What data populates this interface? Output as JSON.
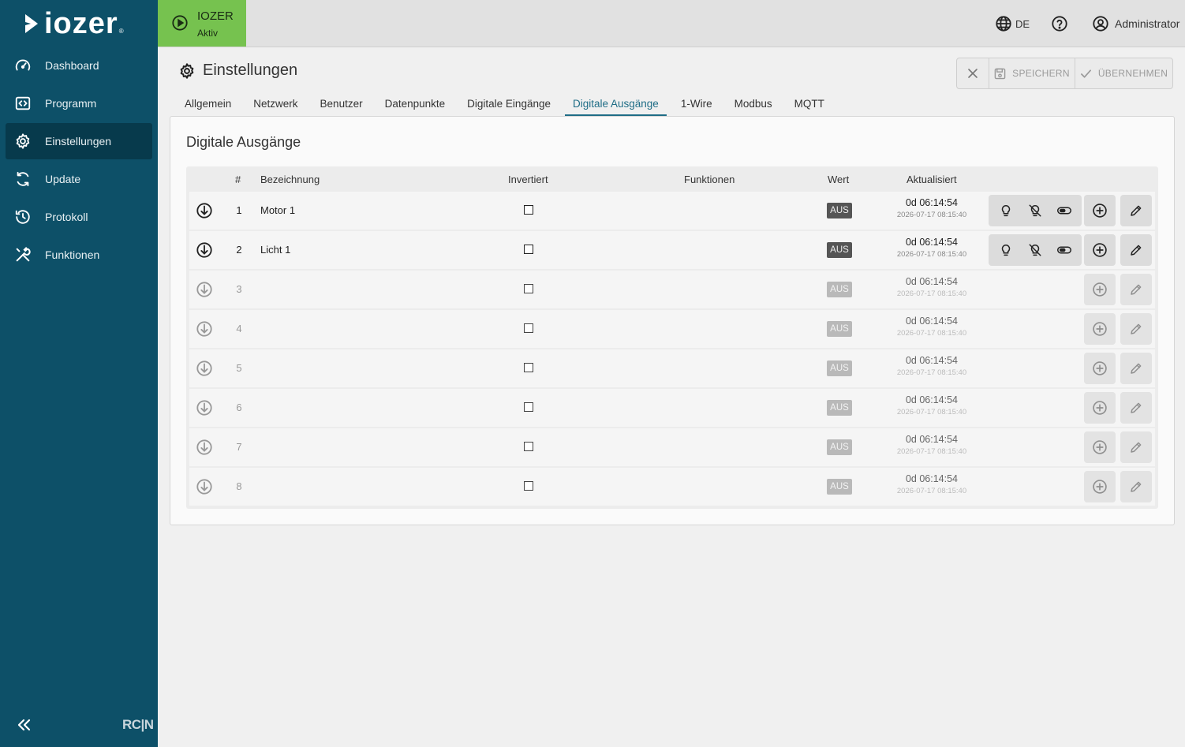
{
  "logo": {
    "text": "IOZER",
    "reg": "®"
  },
  "sidebar": {
    "items": [
      {
        "label": "Dashboard",
        "icon": "gauge-icon",
        "active": false
      },
      {
        "label": "Programm",
        "icon": "code-icon",
        "active": false
      },
      {
        "label": "Einstellungen",
        "icon": "gear-icon",
        "active": true
      },
      {
        "label": "Update",
        "icon": "refresh-icon",
        "active": false
      },
      {
        "label": "Protokoll",
        "icon": "history-icon",
        "active": false
      },
      {
        "label": "Funktionen",
        "icon": "tools-icon",
        "active": false
      }
    ],
    "collapse_icon": "double-chevron-left-icon",
    "brand": "RC|N"
  },
  "header": {
    "status": {
      "title": "IOZER",
      "subtitle": "Aktiv",
      "color": "#76c24f"
    },
    "language": "DE",
    "user": "Administrator"
  },
  "page": {
    "title": "Einstellungen",
    "actions": {
      "save": "SPEICHERN",
      "apply": "ÜBERNEHMEN"
    },
    "tabs": [
      "Allgemein",
      "Netzwerk",
      "Benutzer",
      "Datenpunkte",
      "Digitale Eingänge",
      "Digitale Ausgänge",
      "1-Wire",
      "Modbus",
      "MQTT"
    ],
    "active_tab": "Digitale Ausgänge"
  },
  "card": {
    "title": "Digitale Ausgänge",
    "columns": {
      "num": "#",
      "name": "Bezeichnung",
      "inverted": "Invertiert",
      "functions": "Funktionen",
      "value": "Wert",
      "updated": "Aktualisiert"
    },
    "rows": [
      {
        "num": "1",
        "name": "Motor 1",
        "inverted": false,
        "value": "AUS",
        "uptime": "0d 06:14:54",
        "timestamp": "2026-07-17 08:15:40",
        "active": true
      },
      {
        "num": "2",
        "name": "Licht 1",
        "inverted": false,
        "value": "AUS",
        "uptime": "0d 06:14:54",
        "timestamp": "2026-07-17 08:15:40",
        "active": true
      },
      {
        "num": "3",
        "name": "",
        "inverted": false,
        "value": "AUS",
        "uptime": "0d 06:14:54",
        "timestamp": "2026-07-17 08:15:40",
        "active": false
      },
      {
        "num": "4",
        "name": "",
        "inverted": false,
        "value": "AUS",
        "uptime": "0d 06:14:54",
        "timestamp": "2026-07-17 08:15:40",
        "active": false
      },
      {
        "num": "5",
        "name": "",
        "inverted": false,
        "value": "AUS",
        "uptime": "0d 06:14:54",
        "timestamp": "2026-07-17 08:15:40",
        "active": false
      },
      {
        "num": "6",
        "name": "",
        "inverted": false,
        "value": "AUS",
        "uptime": "0d 06:14:54",
        "timestamp": "2026-07-17 08:15:40",
        "active": false
      },
      {
        "num": "7",
        "name": "",
        "inverted": false,
        "value": "AUS",
        "uptime": "0d 06:14:54",
        "timestamp": "2026-07-17 08:15:40",
        "active": false
      },
      {
        "num": "8",
        "name": "",
        "inverted": false,
        "value": "AUS",
        "uptime": "0d 06:14:54",
        "timestamp": "2026-07-17 08:15:40",
        "active": false
      }
    ]
  },
  "colors": {
    "sidebar": "#0d5068",
    "sidebar_active": "#073a4c",
    "accent": "#1f6d86",
    "status": "#76c24f"
  }
}
